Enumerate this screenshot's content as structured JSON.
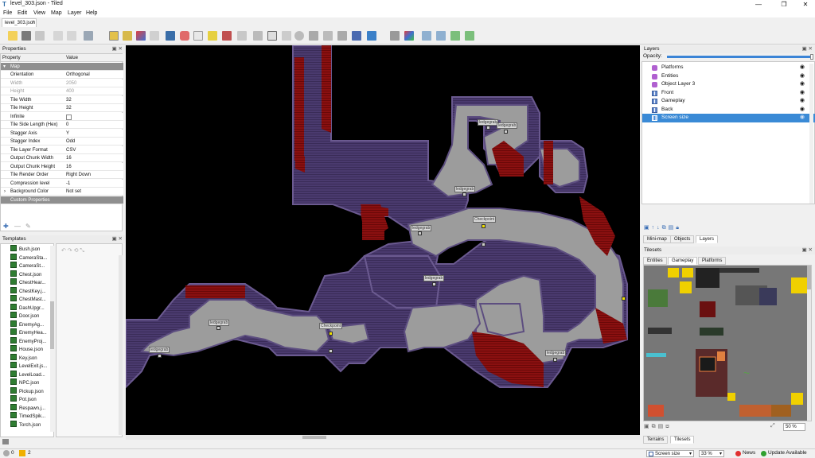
{
  "window": {
    "title": "level_303.json - Tiled",
    "minimize": "—",
    "maximize": "❐",
    "close": "✕"
  },
  "menu": [
    "File",
    "Edit",
    "View",
    "Map",
    "Layer",
    "Help"
  ],
  "document_tab": {
    "label": "level_303.json",
    "close": "×"
  },
  "properties": {
    "title": "Properties",
    "col_property": "Property",
    "col_value": "Value",
    "section_map": "Map",
    "rows": [
      {
        "k": "Orientation",
        "v": "Orthogonal"
      },
      {
        "k": "Width",
        "v": "2050"
      },
      {
        "k": "Height",
        "v": "400"
      },
      {
        "k": "Tile Width",
        "v": "32"
      },
      {
        "k": "Tile Height",
        "v": "32"
      },
      {
        "k": "Infinite",
        "v": ""
      },
      {
        "k": "Tile Side Length (Hex)",
        "v": "0"
      },
      {
        "k": "Stagger Axis",
        "v": "Y"
      },
      {
        "k": "Stagger Index",
        "v": "Odd"
      },
      {
        "k": "Tile Layer Format",
        "v": "CSV"
      },
      {
        "k": "Output Chunk Width",
        "v": "16"
      },
      {
        "k": "Output Chunk Height",
        "v": "16"
      },
      {
        "k": "Tile Render Order",
        "v": "Right Down"
      },
      {
        "k": "Compression level",
        "v": "-1"
      },
      {
        "k": "Background Color",
        "v": "Not set"
      }
    ],
    "section_custom": "Custom Properties"
  },
  "templates": {
    "title": "Templates",
    "items": [
      "Bush.json",
      "CameraSta...",
      "CameraSt...",
      "Chest.json",
      "ChestHear...",
      "ChestKey.j...",
      "ChestMast...",
      "DashUpgr...",
      "Door.json",
      "EnemyAg...",
      "EnemyHea...",
      "EnemyProj...",
      "House.json",
      "Key.json",
      "LevelExit.js...",
      "LevelLoad...",
      "NPC.json",
      "Pickup.json",
      "Pot.json",
      "Respawn.j...",
      "TimedSpik...",
      "Torch.json"
    ]
  },
  "canvas": {
    "labels": [
      "ledgegrab",
      "ledgegrab",
      "ledgegrab",
      "ledgegrab",
      "Checkpoint",
      "ledgegrab",
      "ledgegrab",
      "Checkpoint",
      "ledgegrab",
      "ledgegrab"
    ]
  },
  "layers": {
    "title": "Layers",
    "opacity_label": "Opacity:",
    "rows": [
      {
        "name": "Platforms",
        "kind": "object"
      },
      {
        "name": "Entities",
        "kind": "object"
      },
      {
        "name": "Object Layer 3",
        "kind": "object"
      },
      {
        "name": "Front",
        "kind": "tile"
      },
      {
        "name": "Gameplay",
        "kind": "tile"
      },
      {
        "name": "Back",
        "kind": "tile"
      },
      {
        "name": "Screen size",
        "kind": "tile",
        "selected": true
      }
    ],
    "bottom_tabs": [
      "Mini-map",
      "Objects",
      "Layers"
    ]
  },
  "tilesets": {
    "title": "Tilesets",
    "tabs": [
      "Entities",
      "Gameplay",
      "Platforms"
    ],
    "bottom_tabs": [
      "Terrains",
      "Tilesets"
    ],
    "zoom": "50 %"
  },
  "status": {
    "warnings": "0",
    "errors": "2",
    "layer_select": "Screen size",
    "zoom": "33 %",
    "news": "News",
    "update": "Update Available"
  }
}
